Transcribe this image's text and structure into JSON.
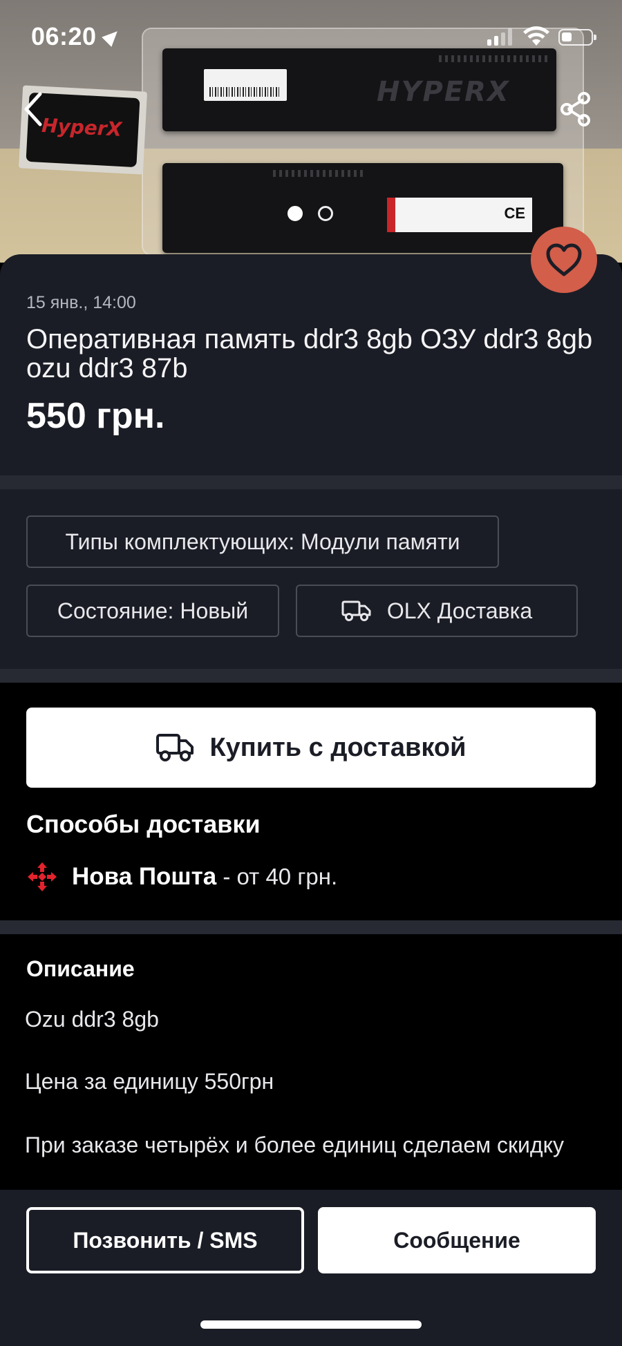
{
  "status_bar": {
    "time": "06:20"
  },
  "gallery": {
    "brand_text": "HYPERX",
    "sticker_text": "HyperX",
    "label_mark": "CE",
    "pages": 2,
    "current_page": 1
  },
  "listing": {
    "date": "15 янв., 14:00",
    "title": "Оперативная память ddr3 8gb ОЗУ ddr3 8gb ozu ddr3 87b",
    "price": "550 грн."
  },
  "params": {
    "type": "Типы комплектующих: Модули памяти",
    "condition": "Состояние: Новый",
    "delivery_badge": "OLX Доставка"
  },
  "delivery": {
    "buy_button": "Купить с доставкой",
    "heading": "Способы доставки",
    "carrier_name": "Нова Пошта",
    "carrier_price": " - от 40 грн."
  },
  "description": {
    "heading": "Описание",
    "lines": [
      "Ozu ddr3 8gb",
      "Цена за единицу 550грн",
      "При заказе четырёх и более единиц сделаем скидку"
    ]
  },
  "actions": {
    "call_button": "Позвонить / SMS",
    "message_button": "Сообщение"
  },
  "colors": {
    "card_bg": "#1b1d26",
    "favorite_bg": "#d35e4a",
    "nova_poshta_red": "#e2232d"
  },
  "icons": {
    "back": "chevron-left-icon",
    "share": "share-icon",
    "favorite": "heart-icon",
    "truck": "truck-icon",
    "nova_poshta": "nova-poshta-logo-icon"
  }
}
